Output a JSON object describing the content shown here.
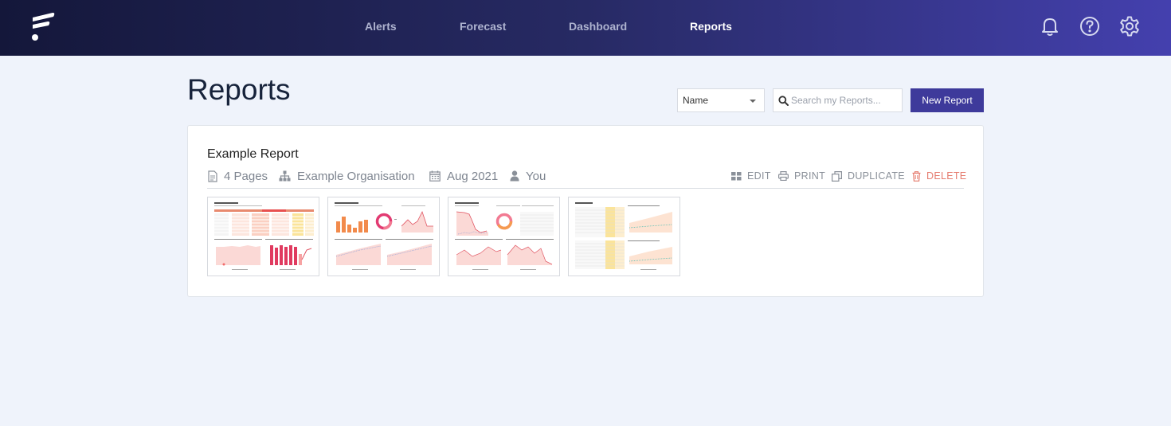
{
  "header": {
    "nav": [
      {
        "label": "Alerts"
      },
      {
        "label": "Forecast"
      },
      {
        "label": "Dashboard"
      },
      {
        "label": "Reports",
        "active": true
      }
    ],
    "icons": [
      "bell-icon",
      "help-icon",
      "settings-icon"
    ]
  },
  "page": {
    "title": "Reports"
  },
  "toolbar": {
    "sort_value": "Name",
    "search_placeholder": "Search my Reports...",
    "search_value": "",
    "new_label": "New Report"
  },
  "report": {
    "title": "Example Report",
    "pages": "4 Pages",
    "organisation": "Example Organisation",
    "date": "Aug 2021",
    "owner": "You",
    "actions": {
      "edit": "EDIT",
      "print": "PRINT",
      "duplicate": "DUPLICATE",
      "delete": "DELETE"
    },
    "thumbnails": [
      "page-1",
      "page-2",
      "page-3",
      "page-4"
    ]
  },
  "colors": {
    "brand_dark": "#14173a",
    "brand_light": "#4440ae",
    "button": "#3e3a9b",
    "delete": "#e57c6f",
    "background": "#eff3fb"
  }
}
